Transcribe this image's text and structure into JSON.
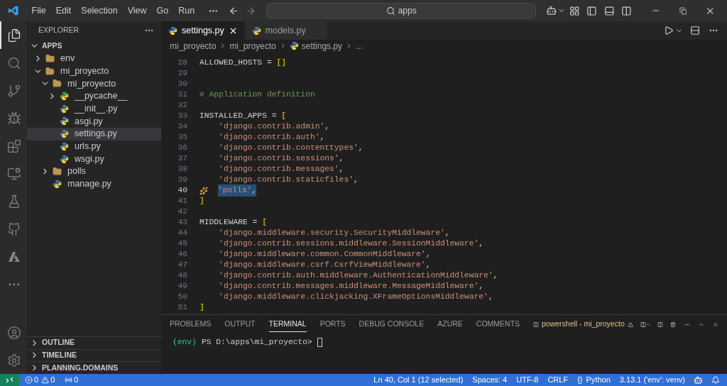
{
  "title_bar": {
    "menu": [
      "File",
      "Edit",
      "Selection",
      "View",
      "Go",
      "Run"
    ],
    "search": {
      "value": "apps"
    }
  },
  "activity_bar": [
    {
      "kind": "files",
      "selected": true
    },
    {
      "kind": "search",
      "selected": false
    },
    {
      "kind": "source-control",
      "selected": false
    },
    {
      "kind": "run-debug",
      "selected": false
    },
    {
      "kind": "extensions",
      "selected": false
    },
    {
      "kind": "remote",
      "selected": false
    },
    {
      "kind": "testing",
      "selected": false
    },
    {
      "kind": "github",
      "selected": false
    },
    {
      "kind": "azure",
      "selected": false
    },
    {
      "kind": "more",
      "selected": false
    },
    {
      "kind": "account",
      "selected": false
    },
    {
      "kind": "settings",
      "selected": false
    }
  ],
  "sidebar": {
    "title": "EXPLORER",
    "root": {
      "label": "APPS",
      "expanded": true
    },
    "tree": [
      {
        "label": "env",
        "kind": "folder",
        "expanded": false,
        "selected": false
      },
      {
        "label": "mi_proyecto",
        "kind": "folder",
        "expanded": true,
        "selected": false,
        "children": [
          {
            "label": "mi_proyecto",
            "kind": "folder",
            "expanded": true,
            "selected": false,
            "children": [
              {
                "label": "__pycache__",
                "kind": "pycache",
                "expanded": false,
                "selected": false
              },
              {
                "label": "__init__.py",
                "kind": "python",
                "selected": false
              },
              {
                "label": "asgi.py",
                "kind": "python",
                "selected": false
              },
              {
                "label": "settings.py",
                "kind": "python",
                "selected": true
              },
              {
                "label": "urls.py",
                "kind": "python",
                "selected": false
              },
              {
                "label": "wsgi.py",
                "kind": "python",
                "selected": false
              }
            ]
          },
          {
            "label": "polls",
            "kind": "folder",
            "expanded": false,
            "selected": false
          },
          {
            "label": "manage.py",
            "kind": "python",
            "selected": false
          }
        ]
      }
    ],
    "sections": [
      {
        "label": "OUTLINE",
        "expanded": false
      },
      {
        "label": "TIMELINE",
        "expanded": false
      },
      {
        "label": "PLANNING.DOMAINS",
        "expanded": false
      }
    ]
  },
  "tabs": [
    {
      "label": "settings.py",
      "selected": true
    },
    {
      "label": "models.py",
      "selected": false
    }
  ],
  "breadcrumb": [
    "mi_proyecto",
    "mi_proyecto",
    "settings.py",
    "..."
  ],
  "code": [
    {
      "number": "28",
      "selected": false,
      "segments": [
        {
          "text": "ALLOWED_HOSTS = ",
          "kind": "plain"
        },
        {
          "text": "[]",
          "kind": "bracket"
        }
      ]
    },
    {
      "number": "29",
      "selected": false
    },
    {
      "number": "30",
      "selected": false
    },
    {
      "number": "31",
      "selected": false,
      "segments": [
        {
          "text": "# Application definition",
          "kind": "comment"
        }
      ]
    },
    {
      "number": "32",
      "selected": false
    },
    {
      "number": "33",
      "selected": false,
      "segments": [
        {
          "text": "INSTALLED_APPS = ",
          "kind": "plain"
        },
        {
          "text": "[",
          "kind": "bracket"
        }
      ]
    },
    {
      "number": "34",
      "selected": false,
      "segments": [
        {
          "text": "    'django.contrib.admin'",
          "kind": "string"
        },
        {
          "text": ",",
          "kind": "plain"
        }
      ]
    },
    {
      "number": "35",
      "selected": false,
      "segments": [
        {
          "text": "    'django.contrib.auth'",
          "kind": "string"
        },
        {
          "text": ",",
          "kind": "plain"
        }
      ]
    },
    {
      "number": "36",
      "selected": false,
      "segments": [
        {
          "text": "    'django.contrib.contenttypes'",
          "kind": "string"
        },
        {
          "text": ",",
          "kind": "plain"
        }
      ]
    },
    {
      "number": "37",
      "selected": false,
      "segments": [
        {
          "text": "    'django.contrib.sessions'",
          "kind": "string"
        },
        {
          "text": ",",
          "kind": "plain"
        }
      ]
    },
    {
      "number": "38",
      "selected": false,
      "segments": [
        {
          "text": "    'django.contrib.messages'",
          "kind": "string"
        },
        {
          "text": ",",
          "kind": "plain"
        }
      ]
    },
    {
      "number": "39",
      "selected": false,
      "segments": [
        {
          "text": "    'django.contrib.staticfiles'",
          "kind": "string"
        },
        {
          "text": ",",
          "kind": "plain"
        }
      ]
    },
    {
      "number": "40",
      "selected": true,
      "segments": [
        {
          "text": "'polls'",
          "kind": "string"
        },
        {
          "text": ",",
          "kind": "plain"
        }
      ]
    },
    {
      "number": "41",
      "selected": false,
      "segments": [
        {
          "text": "]",
          "kind": "bracket"
        }
      ]
    },
    {
      "number": "42",
      "selected": false
    },
    {
      "number": "43",
      "selected": false,
      "segments": [
        {
          "text": "MIDDLEWARE = ",
          "kind": "plain"
        },
        {
          "text": "[",
          "kind": "bracket"
        }
      ]
    },
    {
      "number": "44",
      "selected": false,
      "segments": [
        {
          "text": "    'django.middleware.security.SecurityMiddleware'",
          "kind": "string"
        },
        {
          "text": ",",
          "kind": "plain"
        }
      ]
    },
    {
      "number": "45",
      "selected": false,
      "segments": [
        {
          "text": "    'django.contrib.sessions.middleware.SessionMiddleware'",
          "kind": "string"
        },
        {
          "text": ",",
          "kind": "plain"
        }
      ]
    },
    {
      "number": "46",
      "selected": false,
      "segments": [
        {
          "text": "    'django.middleware.common.CommonMiddleware'",
          "kind": "string"
        },
        {
          "text": ",",
          "kind": "plain"
        }
      ]
    },
    {
      "number": "47",
      "selected": false,
      "segments": [
        {
          "text": "    'django.middleware.csrf.CsrfViewMiddleware'",
          "kind": "string"
        },
        {
          "text": ",",
          "kind": "plain"
        }
      ]
    },
    {
      "number": "48",
      "selected": false,
      "segments": [
        {
          "text": "    'django.contrib.auth.middleware.AuthenticationMiddleware'",
          "kind": "string"
        },
        {
          "text": ",",
          "kind": "plain"
        }
      ]
    },
    {
      "number": "49",
      "selected": false,
      "segments": [
        {
          "text": "    'django.contrib.messages.middleware.MessageMiddleware'",
          "kind": "string"
        },
        {
          "text": ",",
          "kind": "plain"
        }
      ]
    },
    {
      "number": "50",
      "selected": false,
      "segments": [
        {
          "text": "    'django.middleware.clickjacking.XFrameOptionsMiddleware'",
          "kind": "string"
        },
        {
          "text": ",",
          "kind": "plain"
        }
      ]
    },
    {
      "number": "51",
      "selected": false,
      "segments": [
        {
          "text": "]",
          "kind": "bracket"
        }
      ]
    }
  ],
  "panel": {
    "tabs": [
      {
        "label": "PROBLEMS",
        "selected": false
      },
      {
        "label": "OUTPUT",
        "selected": false
      },
      {
        "label": "TERMINAL",
        "selected": true
      },
      {
        "label": "PORTS",
        "selected": false
      },
      {
        "label": "DEBUG CONSOLE",
        "selected": false
      },
      {
        "label": "AZURE",
        "selected": false
      },
      {
        "label": "COMMENTS",
        "selected": false
      }
    ],
    "terminal_name": "powershell - mi_proyecto",
    "prompt": {
      "env": "(env)",
      "path": "PS D:\\apps\\mi_proyecto>"
    }
  },
  "status_bar": {
    "errors": "0",
    "warnings": "0",
    "ports": "0",
    "right": [
      "Ln 40, Col 1 (12 selected)",
      "Spaces: 4",
      "UTF-8",
      "CRLF"
    ],
    "language": {
      "icon": "{}",
      "label": "Python"
    },
    "interpreter": "3.13.1 ('env': venv)"
  }
}
